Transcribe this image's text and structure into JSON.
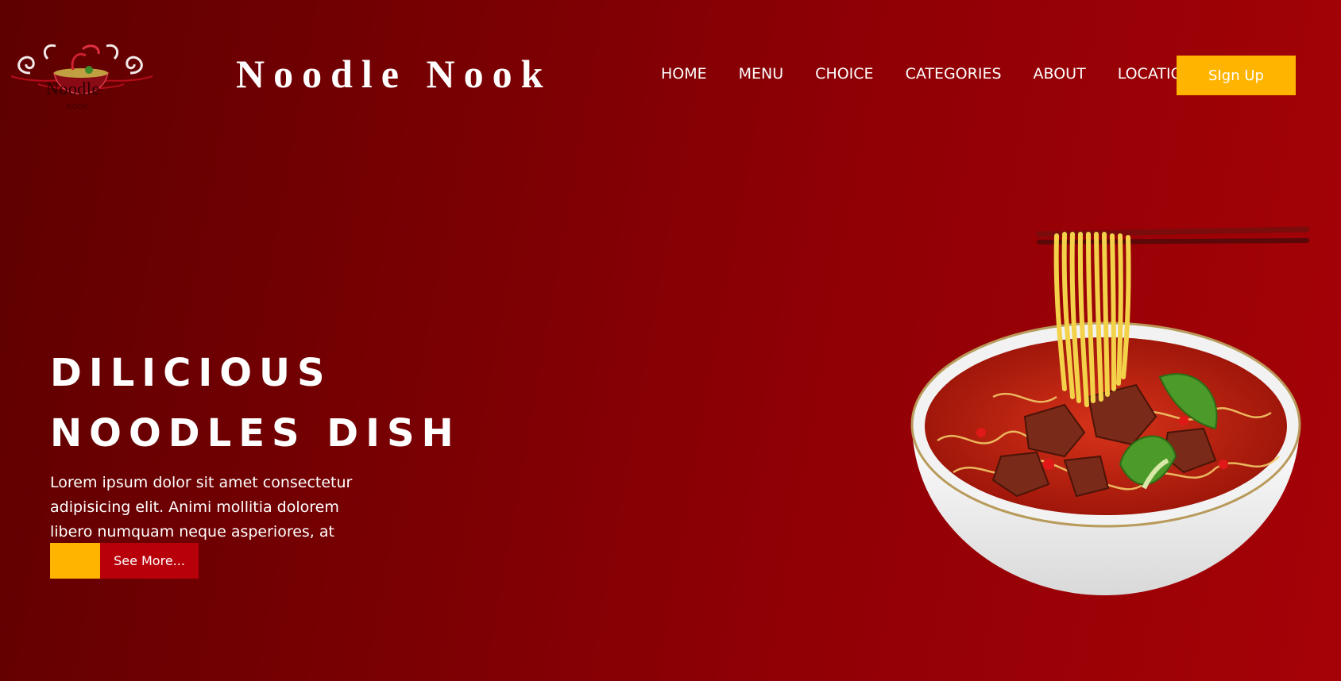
{
  "header": {
    "logo_text": "Noodle",
    "logo_sub": "NOOK",
    "brand": "Noodle Nook",
    "nav": [
      "HOME",
      "MENU",
      "CHOICE",
      "CATEGORIES",
      "ABOUT",
      "LOCATION"
    ],
    "signup_label": "SIgn Up"
  },
  "hero": {
    "title_line1": "DILICIOUS",
    "title_line2": "NOODLES DISH",
    "description": "Lorem ipsum dolor sit amet consectetur adipisicing elit. Animi mollitia dolorem libero numquam neque asperiores, at aperiam. Totam",
    "cta_label": "See More..."
  },
  "colors": {
    "accent": "#ffb400",
    "cta_bg": "#b8000a",
    "bg_dark": "#5e0000",
    "bg_light": "#a50207"
  },
  "icons": {
    "logo": "noodle-bowl-logo",
    "hero_image": "noodle-bowl-image"
  }
}
